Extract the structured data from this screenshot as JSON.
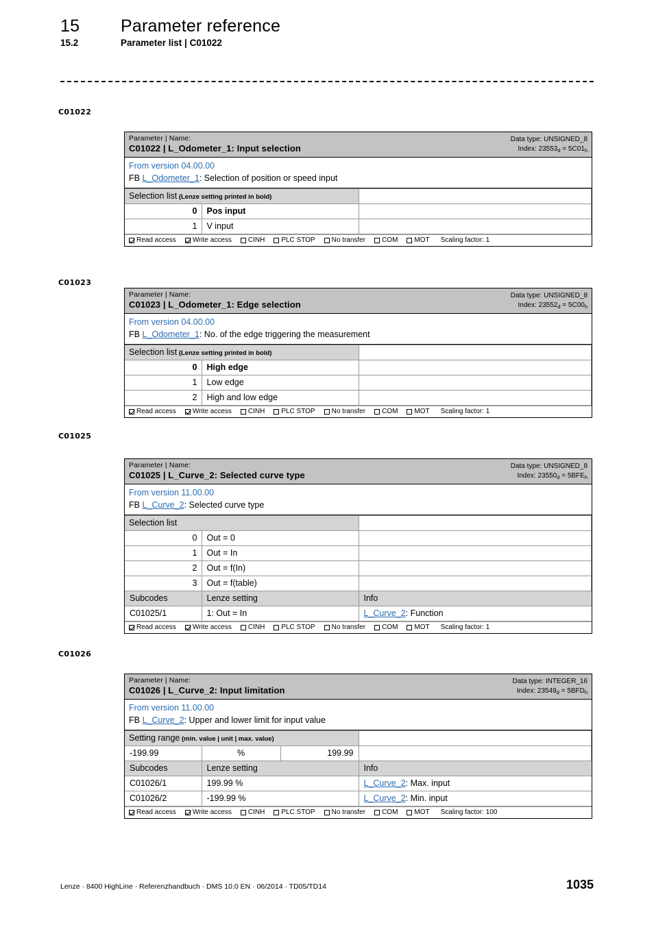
{
  "header": {
    "chapter_number": "15",
    "chapter_title": "Parameter reference",
    "section_number": "15.2",
    "section_title": "Parameter list | C01022"
  },
  "footer": {
    "text": "Lenze · 8400 HighLine · Referenzhandbuch · DMS 10.0 EN · 06/2014 · TD05/TD14",
    "page_number": "1035"
  },
  "labels": {
    "caption_parameter_name": "Parameter | Name:",
    "data_type_prefix": "Data type: ",
    "index_prefix": "Index: ",
    "fb_prefix": "FB ",
    "selection_list": "Selection list",
    "selection_list_note": " (Lenze setting printed in bold)",
    "setting_range": "Setting range",
    "setting_range_note": " (min. value | unit | max. value)",
    "subcodes": "Subcodes",
    "lenze_setting": "Lenze setting",
    "info": "Info",
    "scaling_factor_prefix": "Scaling factor: "
  },
  "access_labels": {
    "read": "Read access",
    "write": "Write access",
    "cinh": "CINH",
    "plc_stop": "PLC STOP",
    "no_transfer": "No transfer",
    "com": "COM",
    "mot": "MOT"
  },
  "blocks": [
    {
      "margin_label": "C01022",
      "title_caption": "Parameter | Name:",
      "title_main": "C01022 | L_Odometer_1: Input selection",
      "data_type": "UNSIGNED_8",
      "index_dec": "23553",
      "index_hex": "5C01",
      "version": "From version 04.00.00",
      "fb_link": "L_Odometer_1",
      "fb_desc": ": Selection of position or speed input",
      "section_title": "Selection list",
      "section_note": " (Lenze setting printed in bold)",
      "selection": [
        {
          "index": "0",
          "value": "Pos input",
          "bold": true
        },
        {
          "index": "1",
          "value": "V input",
          "bold": false
        }
      ],
      "scaling_factor": "1"
    },
    {
      "margin_label": "C01023",
      "title_caption": "Parameter | Name:",
      "title_main": "C01023 | L_Odometer_1: Edge selection",
      "data_type": "UNSIGNED_8",
      "index_dec": "23552",
      "index_hex": "5C00",
      "version": "From version 04.00.00",
      "fb_link": "L_Odometer_1",
      "fb_desc": ": No. of the edge triggering the measurement",
      "section_title": "Selection list",
      "section_note": " (Lenze setting printed in bold)",
      "selection": [
        {
          "index": "0",
          "value": "High edge",
          "bold": true
        },
        {
          "index": "1",
          "value": "Low edge",
          "bold": false
        },
        {
          "index": "2",
          "value": "High and low edge",
          "bold": false
        }
      ],
      "scaling_factor": "1"
    },
    {
      "margin_label": "C01025",
      "title_caption": "Parameter | Name:",
      "title_main": "C01025 | L_Curve_2: Selected curve type",
      "data_type": "UNSIGNED_8",
      "index_dec": "23550",
      "index_hex": "5BFE",
      "version": "From version 11.00.00",
      "fb_link": "L_Curve_2",
      "fb_desc": ": Selected curve type",
      "section_title": "Selection list",
      "section_note": "",
      "selection": [
        {
          "index": "0",
          "value": "Out = 0",
          "bold": false
        },
        {
          "index": "1",
          "value": "Out = In",
          "bold": false
        },
        {
          "index": "2",
          "value": "Out = f(In)",
          "bold": false
        },
        {
          "index": "3",
          "value": "Out = f(table)",
          "bold": false
        }
      ],
      "subcodes": [
        {
          "code": "C01025/1",
          "setting": "1: Out = In",
          "info_link": "L_Curve_2",
          "info_text": ": Function"
        }
      ],
      "scaling_factor": "1"
    },
    {
      "margin_label": "C01026",
      "title_caption": "Parameter | Name:",
      "title_main": "C01026 | L_Curve_2: Input limitation",
      "data_type": "INTEGER_16",
      "index_dec": "23549",
      "index_hex": "5BFD",
      "version": "From version 11.00.00",
      "fb_link": "L_Curve_2",
      "fb_desc": ": Upper and lower limit for input value",
      "section_title": "Setting range",
      "section_note": " (min. value | unit | max. value)",
      "setting_range": {
        "min": "-199.99",
        "unit": "%",
        "max": "199.99"
      },
      "subcodes": [
        {
          "code": "C01026/1",
          "setting": "199.99 %",
          "info_link": "L_Curve_2",
          "info_text": ": Max. input"
        },
        {
          "code": "C01026/2",
          "setting": "-199.99 %",
          "info_link": "L_Curve_2",
          "info_text": ": Min. input"
        }
      ],
      "scaling_factor": "100"
    }
  ]
}
